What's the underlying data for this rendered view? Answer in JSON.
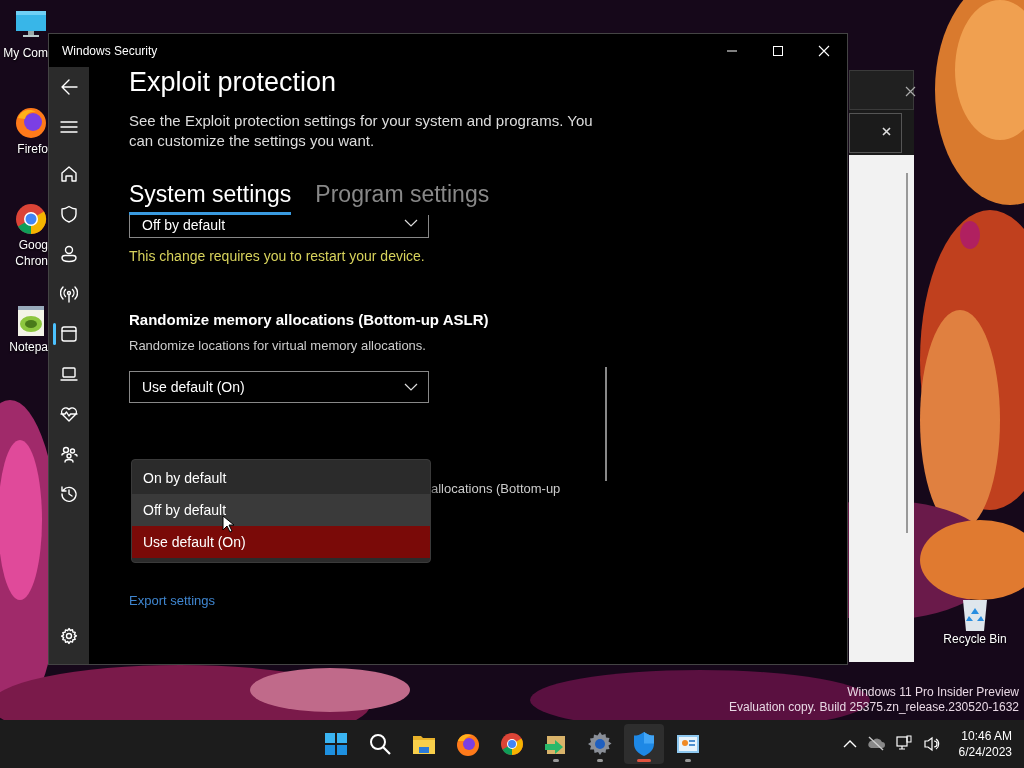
{
  "desktop": {
    "icons": [
      {
        "kind": "monitor",
        "lines": [
          "My Com"
        ]
      },
      {
        "kind": "firefox",
        "lines": [
          "Firefo"
        ]
      },
      {
        "kind": "chrome",
        "lines": [
          "Goog",
          "Chron"
        ]
      },
      {
        "kind": "notepad",
        "lines": [
          "Notepa"
        ]
      }
    ],
    "recycle_bin": {
      "label": "Recycle Bin"
    },
    "build_info": [
      "Windows 11 Pro Insider Preview",
      "Evaluation copy. Build 25375.zn_release.230520-1632"
    ]
  },
  "window": {
    "title": "Windows Security",
    "nav": [
      {
        "kind": "back"
      },
      {
        "kind": "menu"
      },
      {
        "kind": "home",
        "selected": false
      },
      {
        "kind": "shield",
        "selected": false
      },
      {
        "kind": "person",
        "selected": false
      },
      {
        "kind": "antenna",
        "selected": false
      },
      {
        "kind": "app",
        "selected": true
      },
      {
        "kind": "laptop",
        "selected": false
      },
      {
        "kind": "heart",
        "selected": false
      },
      {
        "kind": "family",
        "selected": false
      },
      {
        "kind": "history",
        "selected": false
      },
      {
        "kind": "settings",
        "selected": false
      }
    ],
    "page": {
      "title": "Exploit protection",
      "description": "See the Exploit protection settings for your system and programs.  You can customize the settings you want.",
      "tabs": [
        {
          "label": "System settings",
          "selected": true
        },
        {
          "label": "Program settings",
          "selected": false
        }
      ],
      "top_dropdown": {
        "value": "Off by default"
      },
      "restart_notice": "This change requires you to restart your device.",
      "setting": {
        "title": "Randomize memory allocations (Bottom-up ASLR)",
        "description": "Randomize locations for virtual memory allocations.",
        "dropdown": {
          "value": "Use default (On)"
        }
      },
      "partial_description": "allocations (Bottom-up",
      "menu": [
        {
          "label": "On by default",
          "selected": false,
          "hovered": false
        },
        {
          "label": "Off by default",
          "selected": false,
          "hovered": true
        },
        {
          "label": "Use default (On)",
          "selected": true,
          "hovered": false
        }
      ],
      "export_link": "Export settings"
    }
  },
  "taskbar": {
    "apps": [
      {
        "kind": "start",
        "running": false,
        "selected": false
      },
      {
        "kind": "search",
        "running": false,
        "selected": false
      },
      {
        "kind": "folder",
        "running": false,
        "selected": false
      },
      {
        "kind": "firefox",
        "running": false,
        "selected": false
      },
      {
        "kind": "chrome",
        "running": false,
        "selected": false
      },
      {
        "kind": "package",
        "running": true,
        "selected": false
      },
      {
        "kind": "settings",
        "running": true,
        "selected": false
      },
      {
        "kind": "shield",
        "running": true,
        "selected": true
      },
      {
        "kind": "board",
        "running": true,
        "selected": false
      }
    ],
    "tray": {
      "time": "10:46 AM",
      "date": "6/24/2023"
    }
  }
}
